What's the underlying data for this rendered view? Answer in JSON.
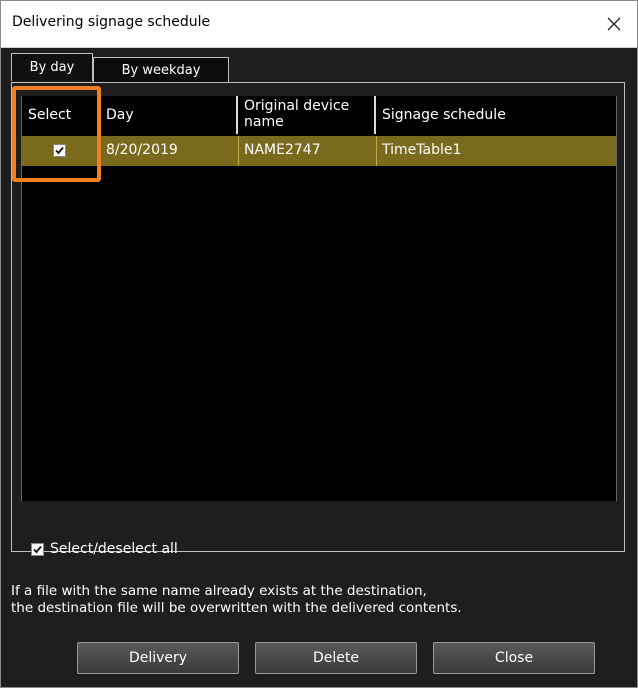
{
  "window": {
    "title": "Delivering signage schedule"
  },
  "tabs": [
    {
      "label": "By day"
    },
    {
      "label": "By weekday"
    }
  ],
  "table": {
    "headers": [
      "Select",
      "Day",
      "Original device name",
      "Signage schedule"
    ],
    "rows": [
      {
        "selected": true,
        "day": "8/20/2019",
        "device": "NAME2747",
        "schedule": "TimeTable1"
      }
    ]
  },
  "select_all": {
    "label": "Select/deselect all",
    "checked": true
  },
  "notice": {
    "line1": "If a file with the same name already exists at the destination,",
    "line2": "the destination file will be overwritten with the delivered contents."
  },
  "buttons": {
    "delivery": "Delivery",
    "delete": "Delete",
    "close": "Close"
  },
  "colors": {
    "selected_row": "#7a6a1e",
    "highlight": "#f08020",
    "background": "#1e1e1e"
  }
}
